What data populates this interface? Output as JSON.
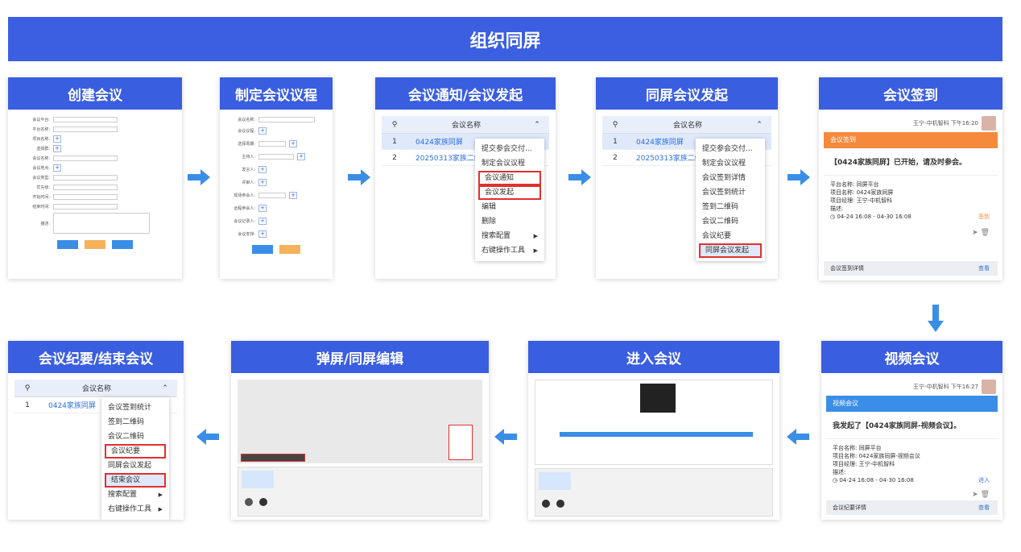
{
  "banner": "组织同屏",
  "steps": {
    "s1": "创建会议",
    "s2": "制定会议议程",
    "s3": "会议通知/会议发起",
    "s4": "同屏会议发起",
    "s5": "会议签到",
    "s6": "视频会议",
    "s7": "进入会议",
    "s8": "弹屏/同屏编辑",
    "s9": "会议纪要/结束会议"
  },
  "table": {
    "col": "会议名称",
    "r1_no": "1",
    "r1": "0424家族同屏",
    "r2_no": "2",
    "r2": "20250313家族二维"
  },
  "menu3": [
    "提交参会交付...",
    "制定会议议程",
    "会议通知",
    "会议发起",
    "编辑",
    "删除",
    "搜索配置",
    "右键操作工具"
  ],
  "menu4": [
    "提交参会交付...",
    "制定会议议程",
    "会议签到详情",
    "会议签到统计",
    "签到二维码",
    "会议二维码",
    "会议纪要",
    "同屏会议发起"
  ],
  "menu9": [
    "会议签到统计",
    "签到二维码",
    "会议二维码",
    "会议纪要",
    "同屏会议发起",
    "结束会议",
    "搜索配置",
    "右键操作工具"
  ],
  "signin": {
    "user": "王宁-中机智科",
    "time": "下午16:20",
    "bar": "会议签到",
    "title": "【0424家族同屏】已开始，请及时参会。",
    "l1": "平台名称: 同屏平台",
    "l2": "项目名称: 0424家族同屏",
    "l3": "项目经理: 王宁-中机智科",
    "l4": "描述:",
    "l5": "◷ 04-24 16:08 - 04-30 16:08",
    "action": "签到",
    "foot": "会议签到详情",
    "link": "查看"
  },
  "video": {
    "user": "王宁-中机智科",
    "time": "下午16:27",
    "bar": "视频会议",
    "title": "我发起了【0424家族同屏-视频会议】。",
    "l1": "平台名称: 同屏平台",
    "l2": "项目名称: 0424家族同屏-视频会议",
    "l3": "项目经理: 王宁-中机智科",
    "l4": "描述:",
    "l5": "◷ 04-24 16:08 - 04-30 16:08",
    "action": "进入",
    "foot": "会议纪要详情",
    "link": "查看"
  },
  "colors": {
    "primary": "#3a5ee0",
    "orange": "#f5893c",
    "video": "#3a8ee6",
    "highlight": "#e0312e"
  }
}
